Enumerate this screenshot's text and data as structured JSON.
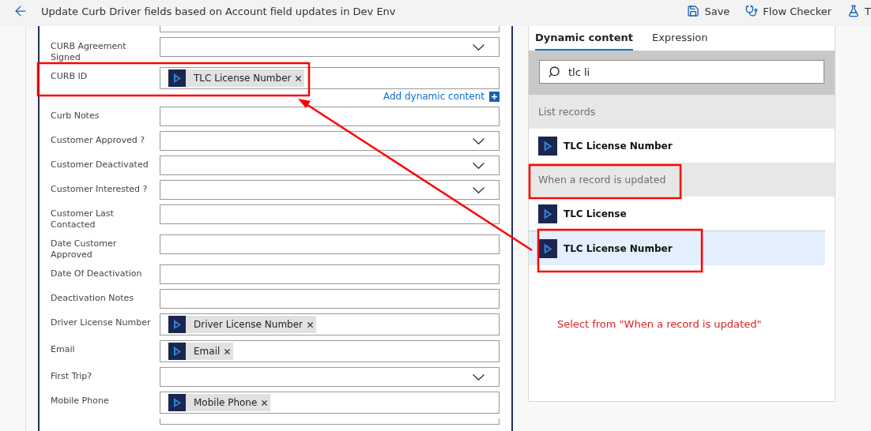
{
  "header": {
    "title": "Update Curb Driver fields based on Account field updates in Dev Env",
    "actions": [
      {
        "kind": "save",
        "label": "Save"
      },
      {
        "kind": "checker",
        "label": "Flow Checker"
      },
      {
        "kind": "test",
        "label": "T"
      }
    ]
  },
  "form": {
    "fields": [
      {
        "kind": "text"
      },
      {
        "kind": "dropdown",
        "label": "CURB Agreement Signed"
      },
      {
        "kind": "token",
        "label": "CURB ID",
        "tokens": [
          "TLC License Number"
        ],
        "focused": true,
        "link": "Add dynamic content"
      },
      {
        "kind": "text",
        "label": "Curb Notes"
      },
      {
        "kind": "dropdown",
        "label": "Customer Approved ?"
      },
      {
        "kind": "dropdown",
        "label": "Customer Deactivated"
      },
      {
        "kind": "dropdown",
        "label": "Customer Interested ?"
      },
      {
        "kind": "text",
        "label": "Customer Last Contacted"
      },
      {
        "kind": "text",
        "label": "Date Customer Approved"
      },
      {
        "kind": "text",
        "label": "Date Of Deactivation"
      },
      {
        "kind": "text",
        "label": "Deactivation Notes"
      },
      {
        "kind": "token",
        "label": "Driver License Number",
        "tokens": [
          "Driver License Number"
        ]
      },
      {
        "kind": "token",
        "label": "Email",
        "tokens": [
          "Email"
        ]
      },
      {
        "kind": "dropdown",
        "label": "First Trip?"
      },
      {
        "kind": "token",
        "label": "Mobile Phone",
        "tokens": [
          "Mobile Phone"
        ]
      },
      {
        "kind": "text"
      }
    ]
  },
  "dynamic_panel": {
    "tabs": [
      {
        "label": "Dynamic content",
        "selected": true
      },
      {
        "label": "Expression",
        "selected": false
      }
    ],
    "search": {
      "value": "tlc li"
    },
    "groups": [
      {
        "title": "List records",
        "items": [
          {
            "label": "TLC License Number",
            "selected": false
          }
        ]
      },
      {
        "title": "When a record is updated",
        "items": [
          {
            "label": "TLC License",
            "selected": false
          },
          {
            "label": "TLC License Number",
            "selected": true
          }
        ]
      }
    ]
  },
  "annotation": {
    "note": "Select from \"When a record is updated\""
  }
}
